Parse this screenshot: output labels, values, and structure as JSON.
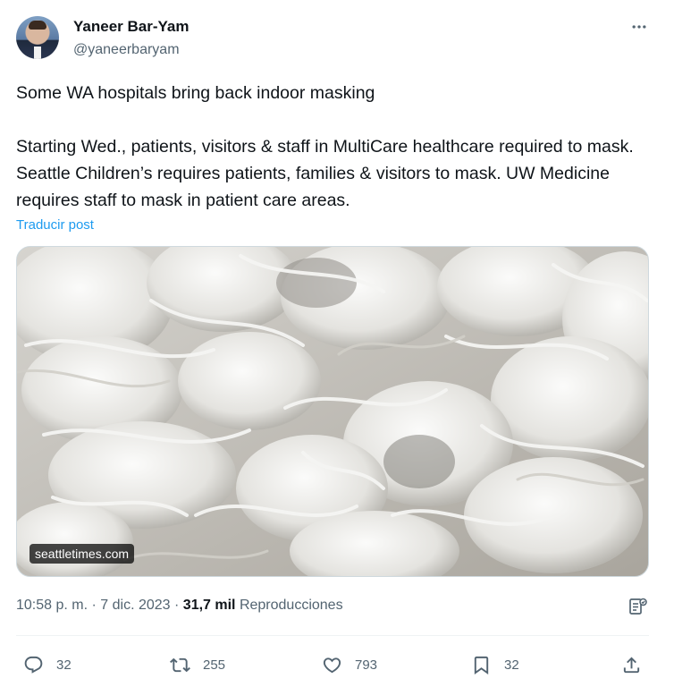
{
  "author": {
    "name": "Yaneer Bar-Yam",
    "handle": "@yaneerbaryam"
  },
  "tweet": {
    "headline": "Some WA hospitals bring back indoor masking",
    "body": "Starting Wed., patients, visitors & staff in MultiCare healthcare required to mask. Seattle Children’s requires patients, families & visitors to mask. UW Medicine requires staff to mask in patient care areas.",
    "translate_label": "Traducir post",
    "media_source": "seattletimes.com"
  },
  "meta": {
    "time": "10:58 p. m.",
    "separator": "·",
    "date": "7 dic. 2023",
    "views_count": "31,7 mil",
    "views_label": "Reproducciones"
  },
  "actions": {
    "replies": "32",
    "reposts": "255",
    "likes": "793",
    "bookmarks": "32"
  },
  "icons": {
    "more": "more-horizontal-icon",
    "analytics": "analytics-icon",
    "reply": "reply-icon",
    "repost": "repost-icon",
    "like": "heart-icon",
    "bookmark": "bookmark-icon",
    "share": "share-icon"
  },
  "colors": {
    "link": "#1d9bf0",
    "secondary_text": "#536471",
    "primary_text": "#0f1419"
  }
}
